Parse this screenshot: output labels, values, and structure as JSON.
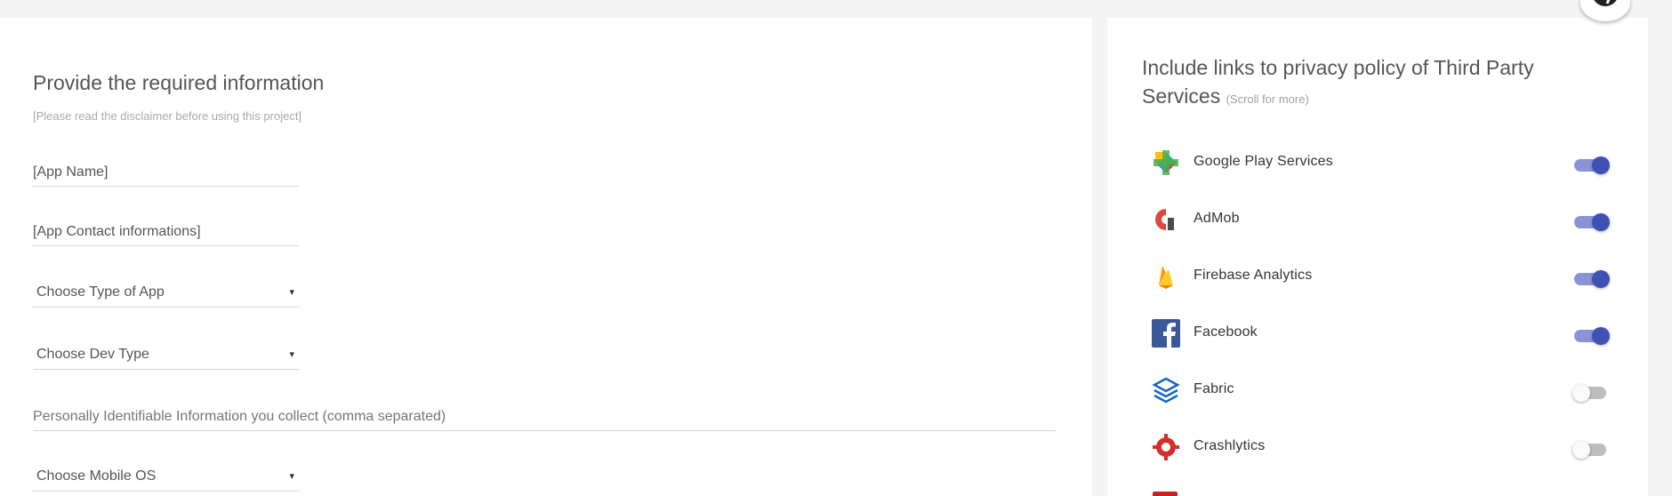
{
  "form": {
    "title": "Provide the required information",
    "disclaimer": "[Please read the disclaimer before using this project]",
    "app_name_value": "[App Name]",
    "app_contact_value": "[App Contact informations]",
    "app_type_select": "Choose Type of App",
    "dev_type_select": "Choose Dev Type",
    "pii_placeholder": "Personally Identifiable Information you collect (comma separated)",
    "mobile_os_select": "Choose Mobile OS",
    "caret": "▾"
  },
  "services": {
    "title": "Include links to privacy policy of Third Party Services",
    "scroll_hint": "(Scroll for more)",
    "items": [
      {
        "label": "Google Play Services",
        "icon": "google-play-services-icon",
        "enabled": true
      },
      {
        "label": "AdMob",
        "icon": "admob-icon",
        "enabled": true
      },
      {
        "label": "Firebase Analytics",
        "icon": "firebase-icon",
        "enabled": true
      },
      {
        "label": "Facebook",
        "icon": "facebook-icon",
        "enabled": true
      },
      {
        "label": "Fabric",
        "icon": "fabric-icon",
        "enabled": false
      },
      {
        "label": "Crashlytics",
        "icon": "crashlytics-icon",
        "enabled": false
      }
    ]
  },
  "colors": {
    "accent": "#3f51b5",
    "accent_track": "#8a93d6",
    "background": "#f4f4f4"
  }
}
